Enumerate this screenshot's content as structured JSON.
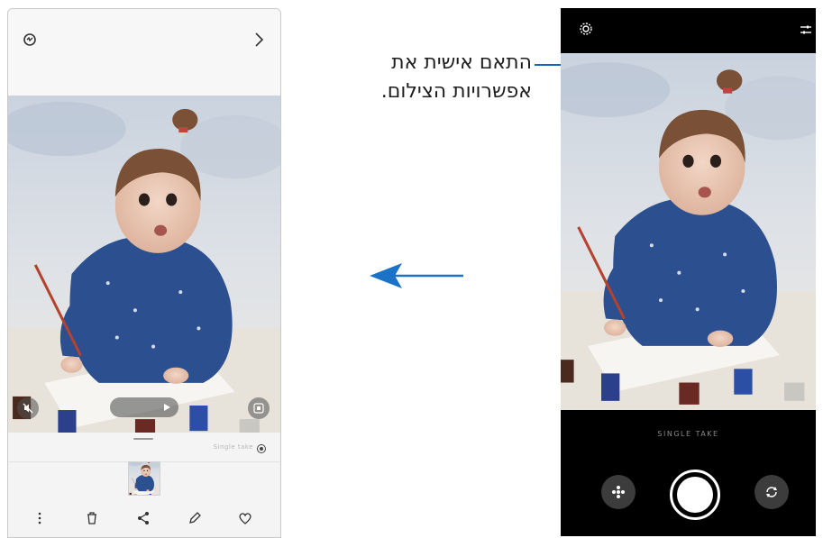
{
  "callout": {
    "line1": "התאם אישית את",
    "line2": "אפשרויות הצילום."
  },
  "gallery": {
    "sheet_label": "Single take",
    "icons": [
      "remaster-icon",
      "chevron-right-icon",
      "mute-icon",
      "play-icon",
      "capture-frame-icon",
      "radio-icon",
      "more-options-icon",
      "trash-icon",
      "share-icon",
      "edit-icon",
      "heart-icon"
    ]
  },
  "camera": {
    "mode_label": "SINGLE TAKE",
    "icons": [
      "settings-gear-icon",
      "adjust-sliders-icon",
      "effects-icon",
      "shutter-button",
      "switch-camera-icon"
    ]
  },
  "colors": {
    "accent_blue": "#1a73c6",
    "line_blue": "#1565c0"
  }
}
